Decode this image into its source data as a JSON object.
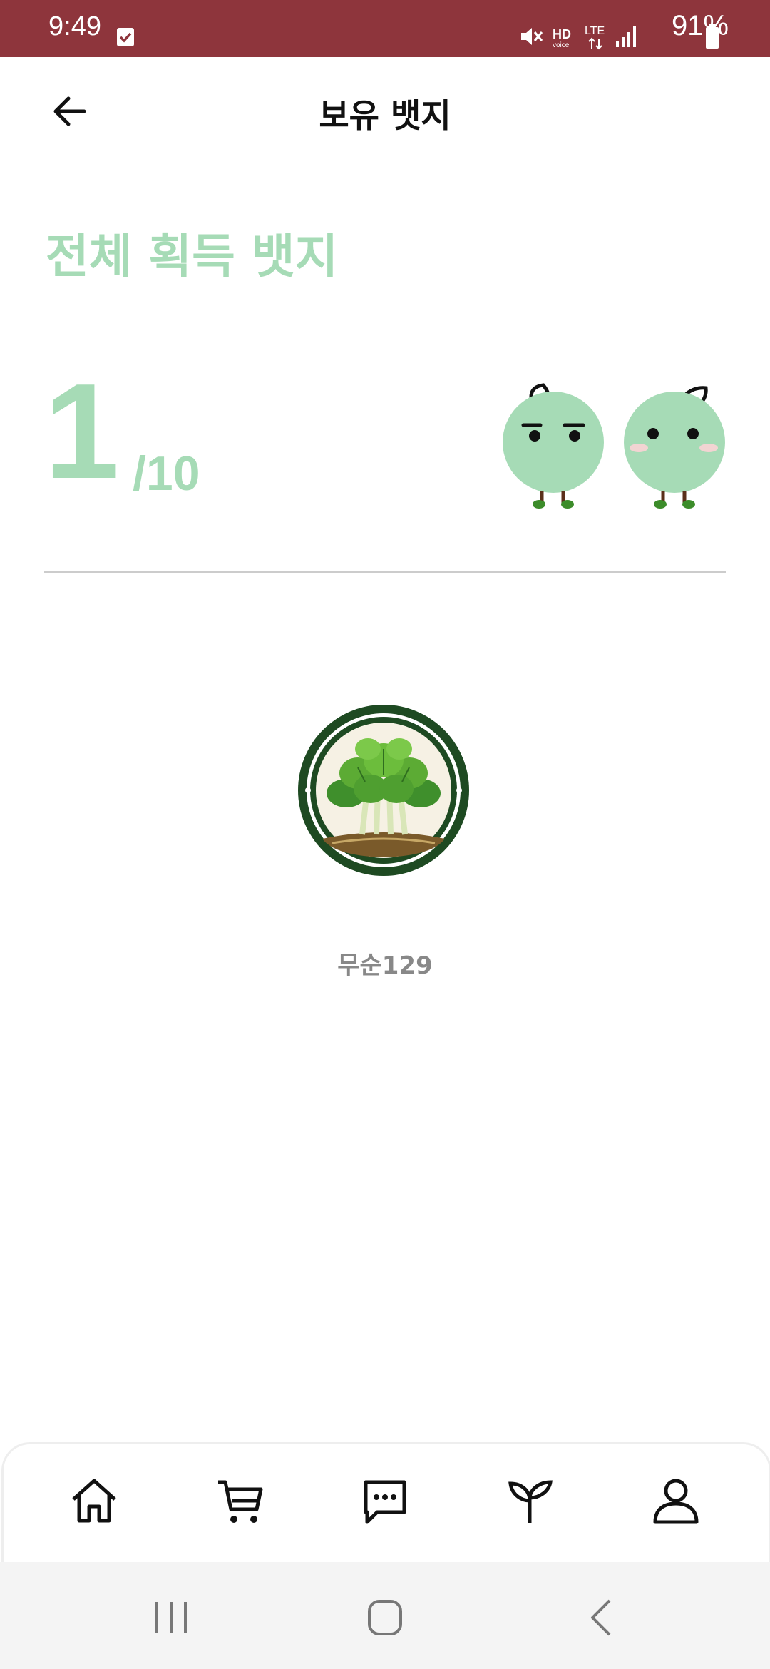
{
  "status_bar": {
    "time": "9:49",
    "battery": "91%",
    "icons": [
      "mute-icon",
      "hd-voice-icon",
      "lte-icon",
      "signal-icon",
      "battery-icon"
    ],
    "background": "#8e353c"
  },
  "header": {
    "title": "보유 뱃지",
    "back_icon": "arrow-left-icon"
  },
  "summary": {
    "section_title": "전체 획득 뱃지",
    "earned": "1",
    "total": "/10",
    "accent_color": "#a6dbb6"
  },
  "badges": [
    {
      "name": "무순129",
      "icon": "sprout-greens-badge"
    }
  ],
  "bottom_nav": {
    "items": [
      {
        "icon": "home-icon"
      },
      {
        "icon": "cart-icon"
      },
      {
        "icon": "chat-icon"
      },
      {
        "icon": "sprout-icon"
      },
      {
        "icon": "profile-icon"
      }
    ]
  },
  "system_nav": [
    "recent-apps-icon",
    "home-circle-icon",
    "back-chevron-icon"
  ]
}
